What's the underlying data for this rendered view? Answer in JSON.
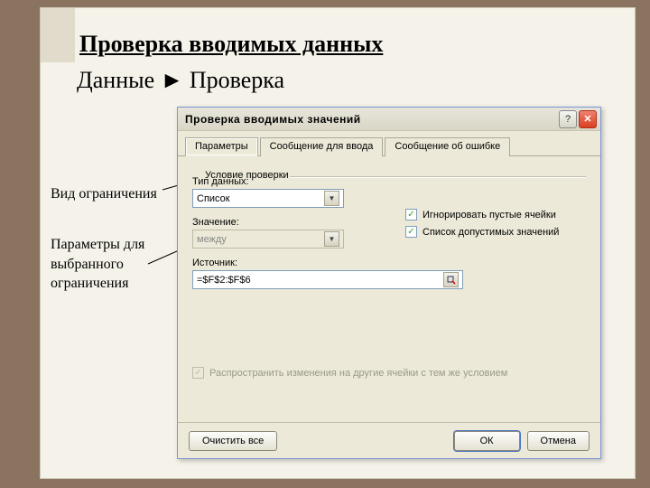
{
  "slide": {
    "title": "Проверка вводимых данных",
    "breadcrumb": "Данные ► Проверка"
  },
  "annotations": {
    "a1": "Вид ограничения",
    "a2": "Параметры для\nвыбранного\nограничения"
  },
  "dialog": {
    "title": "Проверка вводимых значений",
    "help": "?",
    "close": "✕",
    "tabs": {
      "t1": "Параметры",
      "t2": "Сообщение для ввода",
      "t3": "Сообщение об ошибке"
    },
    "group_label": "Условие проверки",
    "type_label": "Тип данных:",
    "type_value": "Список",
    "value_label": "Значение:",
    "value_value": "между",
    "source_label": "Источник:",
    "source_value": "=$F$2:$F$6",
    "cb_ignore": "Игнорировать пустые ячейки",
    "cb_list": "Список допустимых значений",
    "propagate": "Распространить изменения на другие ячейки с тем же условием",
    "buttons": {
      "clear": "Очистить все",
      "ok": "ОК",
      "cancel": "Отмена"
    }
  }
}
